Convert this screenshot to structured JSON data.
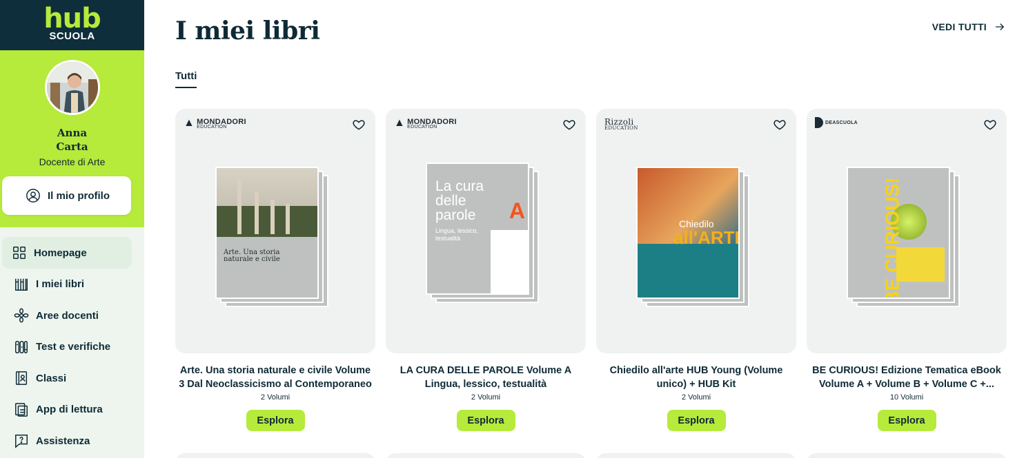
{
  "brand": {
    "logo_top": "hub",
    "logo_bottom": "SCUOLA",
    "accent_color": "#b6ea3b",
    "dark_color": "#0f2e3c"
  },
  "user": {
    "first_name": "Anna",
    "last_name": "Carta",
    "role": "Docente di Arte",
    "profile_button": "Il mio profilo"
  },
  "nav": {
    "items": [
      {
        "label": "Homepage",
        "icon": "grid-icon",
        "active": true
      },
      {
        "label": "I miei libri",
        "icon": "books-icon",
        "active": false
      },
      {
        "label": "Aree docenti",
        "icon": "flower-icon",
        "active": false
      },
      {
        "label": "Test e verifiche",
        "icon": "test-icon",
        "active": false
      },
      {
        "label": "Classi",
        "icon": "classroom-icon",
        "active": false
      },
      {
        "label": "App di lettura",
        "icon": "reader-app-icon",
        "active": false
      },
      {
        "label": "Assistenza",
        "icon": "help-icon",
        "active": false
      }
    ]
  },
  "main": {
    "title": "I miei libri",
    "see_all": "VEDI TUTTI",
    "tab": "Tutti",
    "explore_label": "Esplora",
    "books": [
      {
        "publisher": "MONDADORI",
        "publisher_sub": "EDUCATION",
        "title": "Arte. Una storia naturale e civile Volume 3 Dal Neoclassicismo al Contemporaneo",
        "count": "2 Volumi",
        "cover_title": "Arte. Una storia naturale e civile"
      },
      {
        "publisher": "MONDADORI",
        "publisher_sub": "EDUCATION",
        "title": "LA CURA DELLE PAROLE Volume A Lingua, lessico, testualità",
        "count": "2 Volumi",
        "cover_title": "La cura delle parole",
        "cover_subtitle": "Lingua, lessico, testualità",
        "cover_letter": "A"
      },
      {
        "publisher": "Rizzoli",
        "publisher_sub": "EDUCATION",
        "title": "Chiedilo all'arte HUB Young (Volume unico) + HUB Kit",
        "count": "2 Volumi",
        "cover_title": "Chiedilo",
        "cover_title_2": "all'ARTE"
      },
      {
        "publisher": "DEASCUOLA",
        "publisher_sub": "",
        "title": "BE CURIOUS! Edizione Tematica eBook Volume A + Volume B + Volume C +...",
        "count": "10 Volumi",
        "cover_title": "BE CURIOUS!"
      }
    ]
  }
}
